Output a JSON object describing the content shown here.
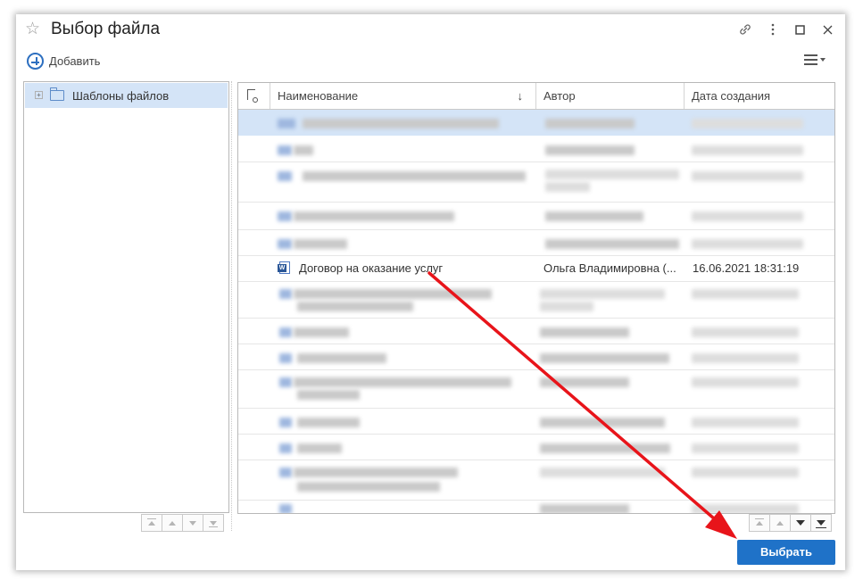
{
  "window": {
    "title": "Выбор файла"
  },
  "toolbar": {
    "add_label": "Добавить"
  },
  "tree": {
    "items": [
      {
        "label": "Шаблоны файлов",
        "selected": true
      }
    ]
  },
  "grid": {
    "columns": [
      {
        "label": "Наименование",
        "sorted": "desc"
      },
      {
        "label": "Автор"
      },
      {
        "label": "Дата создания"
      }
    ],
    "visible_row": {
      "name": "Договор на оказание услуг",
      "author": "Ольга Владимировна (...",
      "date": "16.06.2021 18:31:19"
    }
  },
  "buttons": {
    "select_label": "Выбрать"
  },
  "colors": {
    "accent": "#1f72c8",
    "selection": "#d4e4f7",
    "annotation_arrow": "#e8141a"
  },
  "icons": {
    "favorite": "star-icon",
    "link": "link-icon",
    "more": "more-vertical-icon",
    "maximize": "maximize-icon",
    "close": "close-icon",
    "add": "plus-circle-icon",
    "menu": "hamburger-menu-icon",
    "folder": "folder-icon",
    "word_doc": "word-document-icon"
  }
}
